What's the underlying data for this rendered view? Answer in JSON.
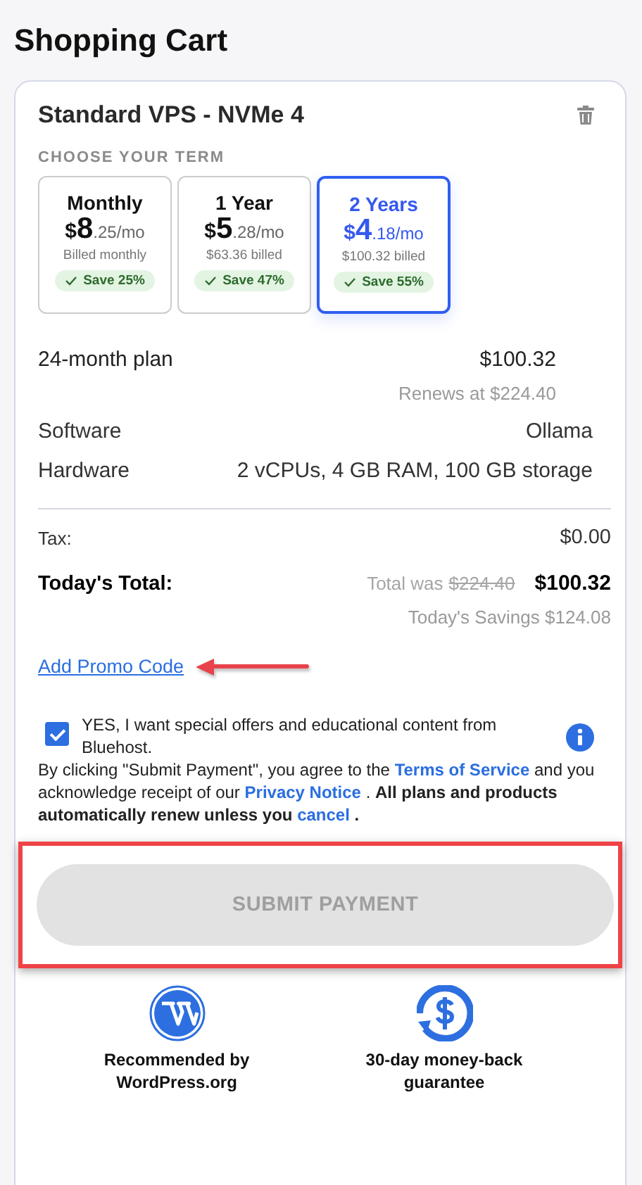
{
  "page_title": "Shopping Cart",
  "product": {
    "name": "Standard VPS - NVMe 4",
    "term_heading": "CHOOSE YOUR TERM"
  },
  "terms": [
    {
      "label": "Monthly",
      "currency": "$",
      "whole": "8",
      "cents": ".25/mo",
      "billed": "Billed monthly",
      "save": "Save 25%",
      "selected": false
    },
    {
      "label": "1 Year",
      "currency": "$",
      "whole": "5",
      "cents": ".28/mo",
      "billed": "$63.36 billed",
      "save": "Save 47%",
      "selected": false
    },
    {
      "label": "2 Years",
      "currency": "$",
      "whole": "4",
      "cents": ".18/mo",
      "billed": "$100.32 billed",
      "save": "Save 55%",
      "selected": true
    }
  ],
  "plan": {
    "label": "24-month plan",
    "price": "$100.32",
    "renews": "Renews at $224.40"
  },
  "details": [
    {
      "label": "Software",
      "value": "Ollama"
    },
    {
      "label": "Hardware",
      "value": "2 vCPUs, 4 GB RAM, 100 GB storage"
    }
  ],
  "tax": {
    "label": "Tax:",
    "value": "$0.00"
  },
  "total": {
    "label": "Today's Total:",
    "was_label": "Total was",
    "was_amount": "$224.40",
    "amount": "$100.32",
    "savings": "Today's Savings $124.08"
  },
  "promo_link": "Add Promo Code",
  "offers": {
    "checked": true,
    "text": "YES, I want special offers and educational content from Bluehost."
  },
  "legal": [
    {
      "kind": "text",
      "text": " By clicking \"Submit Payment\", you agree to the "
    },
    {
      "kind": "link",
      "text": "Terms of Service"
    },
    {
      "kind": "text",
      "text": " and you acknowledge receipt of our "
    },
    {
      "kind": "link",
      "text": "Privacy Notice"
    },
    {
      "kind": "text",
      "text": " .  "
    },
    {
      "kind": "bold",
      "text": "All plans and products automatically renew unless you "
    },
    {
      "kind": "link",
      "text": "cancel"
    },
    {
      "kind": "bold",
      "text": " ."
    }
  ],
  "submit": {
    "label": "SUBMIT PAYMENT",
    "disabled": true
  },
  "badges": [
    {
      "kind": "wordpress",
      "text": "Recommended by WordPress.org"
    },
    {
      "kind": "moneyback",
      "text": "30-day money-back guarantee"
    }
  ]
}
